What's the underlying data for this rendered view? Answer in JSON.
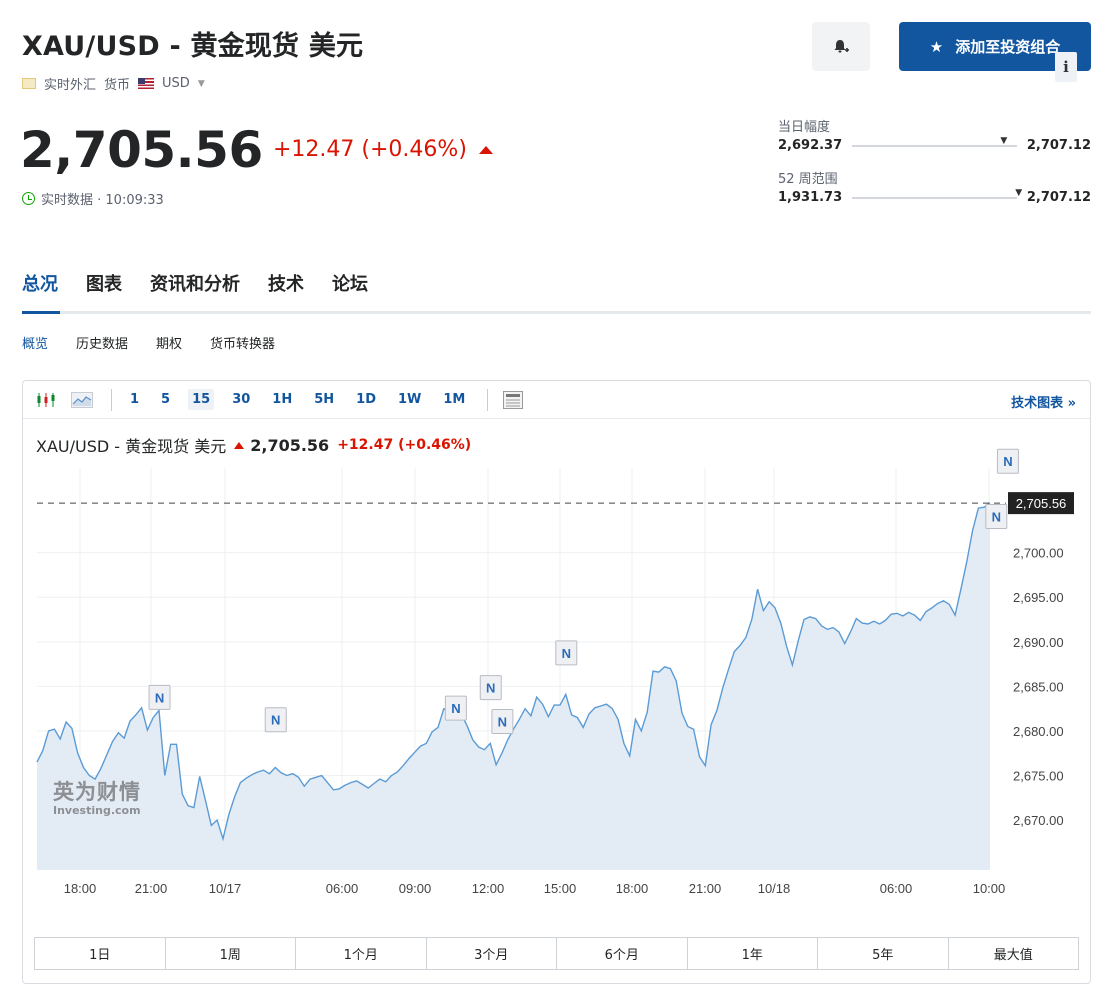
{
  "header": {
    "title": "XAU/USD - 黄金现货 美元",
    "market_status": "实时外汇",
    "currency_label": "货币",
    "currency": "USD",
    "add_portfolio_label": "添加至投资组合"
  },
  "quote": {
    "price": "2,705.56",
    "change": "+12.47 (+0.46%)",
    "realtime_label": "实时数据 · 10:09:33"
  },
  "ranges": {
    "day": {
      "label": "当日幅度",
      "low": "2,692.37",
      "high": "2,707.12",
      "position": 0.9
    },
    "week52": {
      "label": "52 周范围",
      "low": "1,931.73",
      "high": "2,707.12",
      "position": 0.99
    }
  },
  "tabs": [
    "总况",
    "图表",
    "资讯和分析",
    "技术",
    "论坛"
  ],
  "subtabs": [
    "概览",
    "历史数据",
    "期权",
    "货币转换器"
  ],
  "toolbar": {
    "intervals": [
      "1",
      "5",
      "15",
      "30",
      "1H",
      "5H",
      "1D",
      "1W",
      "1M"
    ],
    "selected_interval": "15",
    "tech_chart_label": "技术图表 »"
  },
  "chart_head": {
    "name": "XAU/USD - 黄金现货 美元",
    "price": "2,705.56",
    "change": "+12.47 (+0.46%)",
    "info_label": "i"
  },
  "watermark": {
    "cn": "英为财情",
    "en": "Investing.com"
  },
  "periods": [
    "1日",
    "1周",
    "1个月",
    "3个月",
    "6个月",
    "1年",
    "5年",
    "最大值"
  ],
  "chart_data": {
    "type": "area",
    "x_tick_labels": [
      "18:00",
      "21:00",
      "10/17",
      "06:00",
      "09:00",
      "12:00",
      "15:00",
      "18:00",
      "21:00",
      "10/18",
      "06:00",
      "10:00"
    ],
    "y_tick_labels": [
      "2,700.00",
      "2,695.00",
      "2,690.00",
      "2,685.00",
      "2,680.00",
      "2,675.00",
      "2,670.00"
    ],
    "y_ticks": [
      2700,
      2695,
      2690,
      2685,
      2680,
      2675,
      2670
    ],
    "ylim": [
      2664.4,
      2709.5
    ],
    "current_price": 2705.56,
    "current_price_label": "2,705.56",
    "news_marker_label": "N",
    "news_markers": [
      {
        "index": 21,
        "value": 2679.5
      },
      {
        "index": 41,
        "value": 2677.0
      },
      {
        "index": 72,
        "value": 2678.3
      },
      {
        "index": 78,
        "value": 2680.6
      },
      {
        "index": 80,
        "value": 2676.8
      },
      {
        "index": 91,
        "value": 2684.5
      },
      {
        "index": 165,
        "value": 2699.8
      },
      {
        "index": 167,
        "value": 2706.0
      }
    ],
    "color": "#5b9bd5",
    "fill": "#e3ecf5",
    "values": [
      2676.5,
      2677.8,
      2680.0,
      2680.2,
      2679.1,
      2681.0,
      2680.3,
      2677.5,
      2675.9,
      2675.0,
      2674.6,
      2675.8,
      2677.3,
      2678.8,
      2679.8,
      2679.2,
      2681.1,
      2681.8,
      2682.6,
      2680.1,
      2681.5,
      2682.3,
      2675.0,
      2678.5,
      2678.5,
      2672.9,
      2671.6,
      2671.4,
      2674.9,
      2672.2,
      2669.4,
      2670.0,
      2667.9,
      2670.6,
      2672.6,
      2674.2,
      2674.7,
      2675.1,
      2675.4,
      2675.6,
      2675.2,
      2675.9,
      2675.3,
      2675.0,
      2675.2,
      2674.8,
      2673.8,
      2674.6,
      2674.8,
      2675.0,
      2674.2,
      2673.4,
      2673.5,
      2673.9,
      2674.2,
      2674.4,
      2674.0,
      2673.6,
      2674.1,
      2674.6,
      2674.3,
      2675.0,
      2675.4,
      2676.1,
      2676.9,
      2677.6,
      2678.3,
      2678.6,
      2679.9,
      2680.4,
      2682.5,
      2682.2,
      2681.4,
      2681.9,
      2680.6,
      2679.0,
      2678.2,
      2677.9,
      2678.6,
      2676.2,
      2677.5,
      2679.0,
      2680.2,
      2681.3,
      2682.5,
      2681.7,
      2683.8,
      2683.0,
      2681.6,
      2682.9,
      2682.9,
      2684.1,
      2681.8,
      2681.5,
      2680.4,
      2681.9,
      2682.6,
      2682.8,
      2683.0,
      2682.5,
      2681.3,
      2678.6,
      2677.2,
      2681.3,
      2680.0,
      2682.1,
      2686.7,
      2686.6,
      2687.2,
      2687.0,
      2685.6,
      2682.0,
      2680.5,
      2680.2,
      2677.1,
      2676.1,
      2680.7,
      2682.3,
      2684.8,
      2686.9,
      2688.9,
      2689.6,
      2690.5,
      2692.5,
      2695.9,
      2693.5,
      2694.5,
      2693.8,
      2692.1,
      2689.5,
      2687.4,
      2690.1,
      2692.5,
      2692.8,
      2692.6,
      2691.8,
      2691.4,
      2691.6,
      2691.1,
      2689.8,
      2691.1,
      2692.6,
      2692.1,
      2692.0,
      2692.3,
      2692.0,
      2692.4,
      2693.1,
      2693.2,
      2692.9,
      2693.3,
      2693.0,
      2692.4,
      2693.4,
      2693.8,
      2694.3,
      2694.6,
      2694.2,
      2693.0,
      2695.9,
      2699.0,
      2702.5,
      2705.0,
      2705.1,
      2705.6
    ]
  }
}
